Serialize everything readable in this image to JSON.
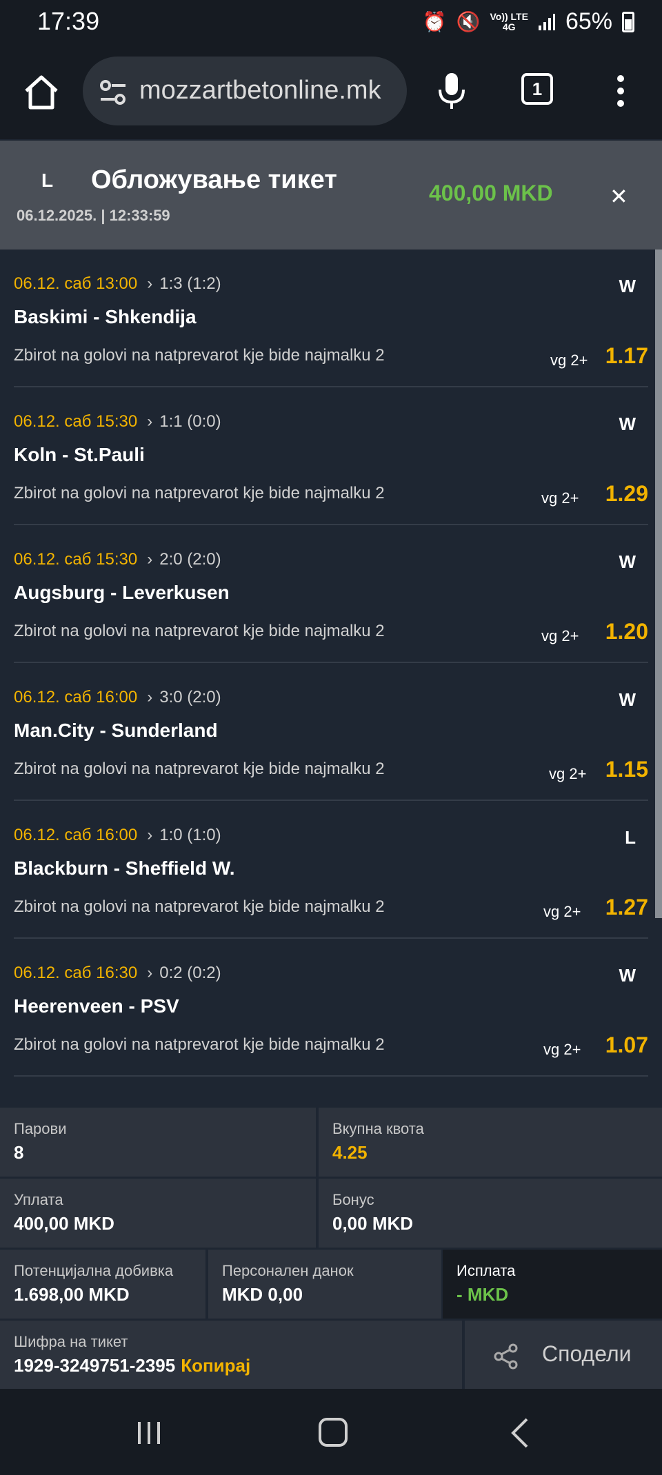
{
  "status_bar": {
    "time": "17:39",
    "net_line1": "Vo)) LTE",
    "net_line2": "4G",
    "battery": "65%"
  },
  "browser": {
    "url": "mozzartbetonline.mk",
    "tab_count": "1"
  },
  "ticket": {
    "status": "L",
    "title": "Обложување тикет",
    "datetime": "06.12.2025. | 12:33:59",
    "amount": "400,00 MKD"
  },
  "events": [
    {
      "date": "06.12. саб 13:00",
      "score": "1:3 (1:2)",
      "result": "W",
      "match": "Baskimi - Shkendija",
      "market": "Zbirot na golovi na natprevarot kje bide najmalku 2",
      "pick": "vg 2+",
      "odd": "1.17"
    },
    {
      "date": "06.12. саб 15:30",
      "score": "1:1 (0:0)",
      "result": "W",
      "match": "Koln - St.Pauli",
      "market": "Zbirot na golovi na natprevarot kje bide najmalku 2",
      "pick": "vg 2+",
      "odd": "1.29"
    },
    {
      "date": "06.12. саб 15:30",
      "score": "2:0 (2:0)",
      "result": "W",
      "match": "Augsburg - Leverkusen",
      "market": "Zbirot na golovi na natprevarot kje bide najmalku 2",
      "pick": "vg 2+",
      "odd": "1.20"
    },
    {
      "date": "06.12. саб 16:00",
      "score": "3:0 (2:0)",
      "result": "W",
      "match": "Man.City - Sunderland",
      "market": "Zbirot na golovi na natprevarot kje bide najmalku 2",
      "pick": "vg 2+",
      "odd": "1.15"
    },
    {
      "date": "06.12. саб 16:00",
      "score": "1:0 (1:0)",
      "result": "L",
      "match": "Blackburn - Sheffield W.",
      "market": "Zbirot na golovi na natprevarot kje bide najmalku 2",
      "pick": "vg 2+",
      "odd": "1.27"
    },
    {
      "date": "06.12. саб 16:30",
      "score": "0:2 (0:2)",
      "result": "W",
      "match": "Heerenveen - PSV",
      "market": "Zbirot na golovi na natprevarot kje bide najmalku 2",
      "pick": "vg 2+",
      "odd": "1.07"
    }
  ],
  "summary": {
    "pairs_label": "Парови",
    "pairs_value": "8",
    "total_odds_label": "Вкупна квота",
    "total_odds_value": "4.25",
    "stake_label": "Уплата",
    "stake_value": "400,00 MKD",
    "bonus_label": "Бонус",
    "bonus_value": "0,00 MKD",
    "potential_label": "Потенцијална добивка",
    "potential_value": "1.698,00 MKD",
    "tax_label": "Персонален данок",
    "tax_value": "MKD 0,00",
    "payout_label": "Исплата",
    "payout_value": "- MKD",
    "code_label": "Шифра на тикет",
    "code_value": "1929-3249751-2395",
    "copy_label": "Копирај",
    "share_label": "Сподели"
  },
  "colors": {
    "accent_yellow": "#f2b300",
    "accent_green": "#6cc24a",
    "background": "#1e2632"
  }
}
